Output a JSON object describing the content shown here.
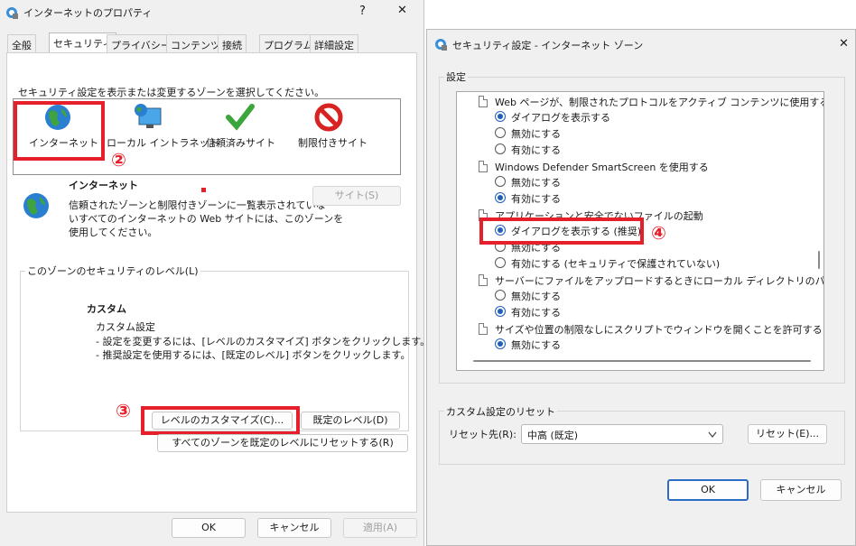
{
  "left_window": {
    "title": "インターネットのプロパティ",
    "help_glyph": "?",
    "close_glyph": "✕",
    "tabs": [
      "全般",
      "セキュリティ",
      "プライバシー",
      "コンテンツ",
      "接続",
      "プログラム",
      "詳細設定"
    ],
    "zone_prompt": "セキュリティ設定を表示または変更するゾーンを選択してください。",
    "zones": [
      "インターネット",
      "ローカル イントラネット",
      "信頼済みサイト",
      "制限付きサイト"
    ],
    "zone_title": "インターネット",
    "zone_desc": [
      "信頼されたゾーンと制限付きゾーンに一覧表示されていな",
      "いすべてのインターネットの Web サイトには、このゾーンを",
      "使用してください。"
    ],
    "sites_button": "サイト(S)",
    "security_level_group": "このゾーンのセキュリティのレベル(L)",
    "custom_title": "カスタム",
    "custom_desc": [
      "カスタム設定",
      "- 設定を変更するには、[レベルのカスタマイズ] ボタンをクリックします。",
      "- 推奨設定を使用するには、[既定のレベル] ボタンをクリックします。"
    ],
    "customize_button": "レベルのカスタマイズ(C)...",
    "default_level_button": "既定のレベル(D)",
    "reset_all_button": "すべてのゾーンを既定のレベルにリセットする(R)",
    "ok": "OK",
    "cancel": "キャンセル",
    "apply": "適用(A)"
  },
  "annotations": [
    "②",
    "③",
    "④"
  ],
  "right_window": {
    "title": "セキュリティ設定 - インターネット ゾーン",
    "close_glyph": "✕",
    "settings_group": "設定",
    "items": [
      {
        "type": "header",
        "label": "Web ページが、制限されたプロトコルをアクティブ コンテンツに使用することを許"
      },
      {
        "type": "option",
        "label": "ダイアログを表示する",
        "checked": true
      },
      {
        "type": "option",
        "label": "無効にする",
        "checked": false
      },
      {
        "type": "option",
        "label": "有効にする",
        "checked": false
      },
      {
        "type": "header",
        "label": "Windows Defender SmartScreen を使用する"
      },
      {
        "type": "option",
        "label": "無効にする",
        "checked": false
      },
      {
        "type": "option",
        "label": "有効にする",
        "checked": true
      },
      {
        "type": "header",
        "label": "アプリケーションと安全でないファイルの起動"
      },
      {
        "type": "option",
        "label": "ダイアログを表示する (推奨)",
        "checked": true
      },
      {
        "type": "option",
        "label": "無効にする",
        "checked": false
      },
      {
        "type": "option",
        "label": "有効にする (セキュリティで保護されていない)",
        "checked": false
      },
      {
        "type": "header",
        "label": "サーバーにファイルをアップロードするときにローカル ディレクトリのパスを含める"
      },
      {
        "type": "option",
        "label": "無効にする",
        "checked": false
      },
      {
        "type": "option",
        "label": "有効にする",
        "checked": true
      },
      {
        "type": "header",
        "label": "サイズや位置の制限なしにスクリプトでウィンドウを開くことを許可する"
      },
      {
        "type": "option",
        "label": "無効にする",
        "checked": true
      }
    ],
    "reset_group": "カスタム設定のリセット",
    "reset_to_label": "リセット先(R):",
    "reset_to_value": "中高 (既定)",
    "reset_button": "リセット(E)...",
    "ok": "OK",
    "cancel": "キャンセル"
  },
  "colors": {
    "annotation_red": "#e5202a",
    "accent_blue": "#1f5fb8"
  },
  "icons": [
    "ie-settings-icon",
    "globe-icon",
    "intranet-icon",
    "check-icon",
    "restricted-icon"
  ]
}
